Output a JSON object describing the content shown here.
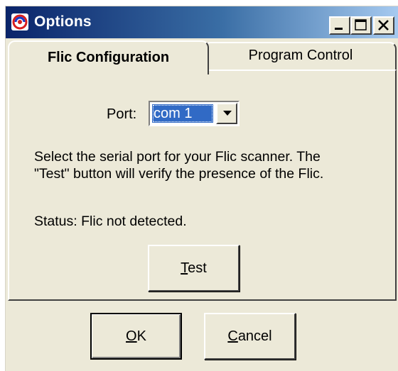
{
  "window": {
    "title": "Options",
    "icon": "app-swirl-icon",
    "controls": [
      "minimize-icon",
      "maximize-icon",
      "close-icon"
    ]
  },
  "tabs": [
    {
      "label": "Flic Configuration",
      "active": true
    },
    {
      "label": "Program Control",
      "active": false
    }
  ],
  "config": {
    "port_label": "Port:",
    "port_value": "com 1",
    "description_line1": "Select the serial port for your Flic scanner. The",
    "description_line2": "\"Test\" button will verify the presence of the Flic.",
    "status": "Status: Flic not detected.",
    "test_button": {
      "accel": "T",
      "rest": "est"
    }
  },
  "buttons": {
    "ok": {
      "accel": "O",
      "rest": "K"
    },
    "cancel": {
      "accel": "C",
      "rest": "ancel"
    }
  },
  "colors": {
    "title_start": "#0a246a",
    "title_end": "#a6caf0",
    "face": "#ece9d8",
    "selection": "#316ac5"
  }
}
